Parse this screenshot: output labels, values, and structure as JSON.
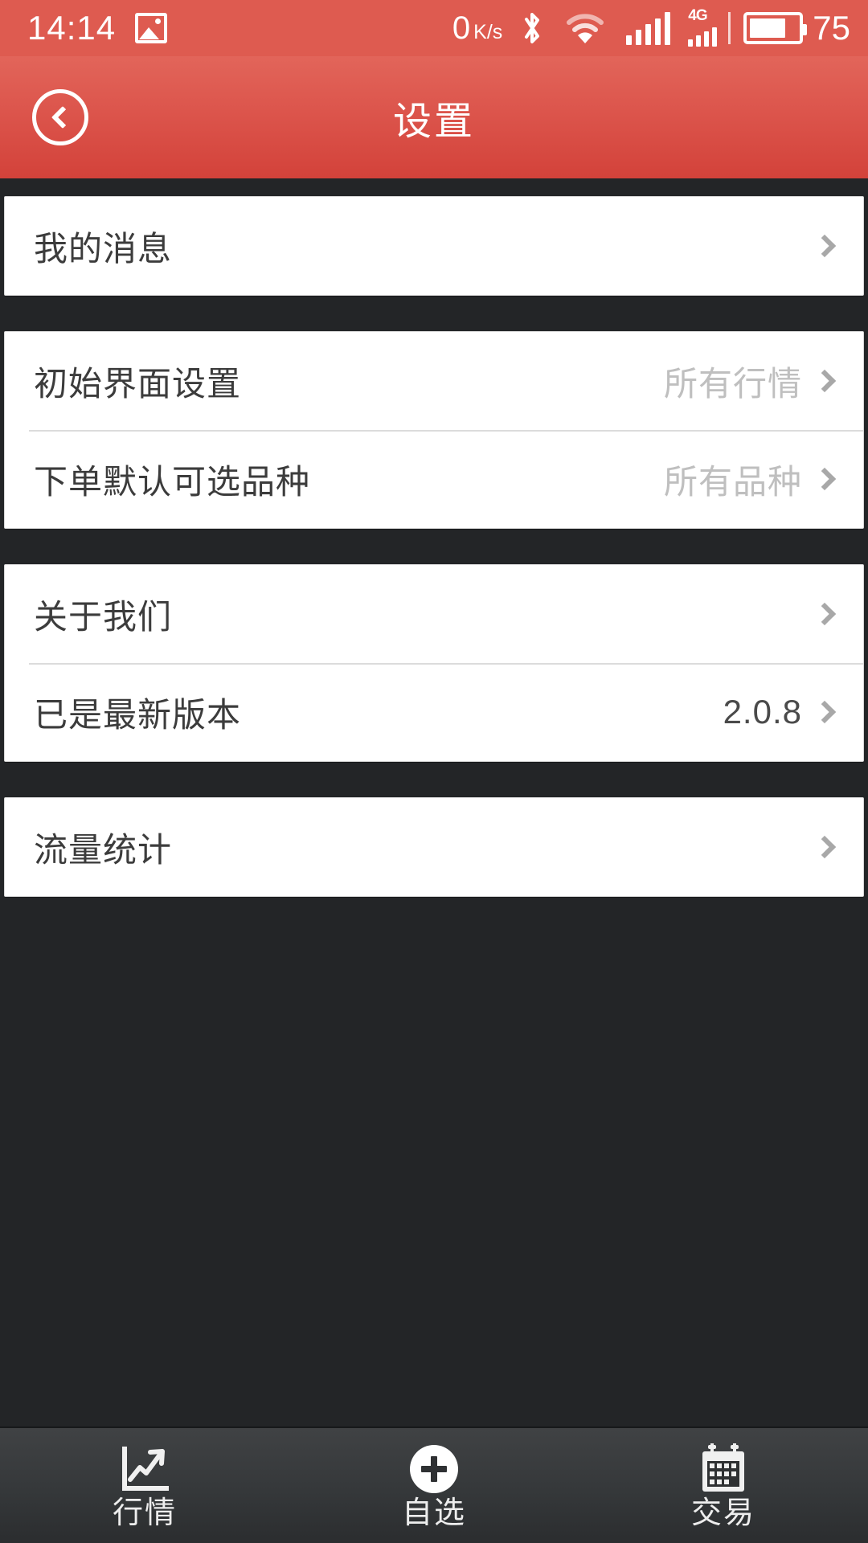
{
  "statusbar": {
    "time": "14:14",
    "gallery_icon": "image-icon",
    "network_speed_value": "0",
    "network_speed_unit": "K/s",
    "bluetooth_icon": "bluetooth-icon",
    "wifi_icon": "wifi-icon",
    "signal_icon": "cellular-signal-icon",
    "signal_4g_label": "4G",
    "battery_icon": "battery-icon",
    "battery_percent": "75"
  },
  "header": {
    "back_icon": "back-arrow-icon",
    "title": "设置"
  },
  "groups": [
    {
      "rows": [
        {
          "label": "我的消息",
          "value": "",
          "value_dark": false
        }
      ]
    },
    {
      "rows": [
        {
          "label": "初始界面设置",
          "value": "所有行情",
          "value_dark": false
        },
        {
          "label": "下单默认可选品种",
          "value": "所有品种",
          "value_dark": false
        }
      ]
    },
    {
      "rows": [
        {
          "label": "关于我们",
          "value": "",
          "value_dark": false
        },
        {
          "label": "已是最新版本",
          "value": "2.0.8",
          "value_dark": true
        }
      ]
    },
    {
      "rows": [
        {
          "label": "流量统计",
          "value": "",
          "value_dark": false
        }
      ]
    }
  ],
  "navbar": {
    "items": [
      {
        "label": "行情",
        "icon": "line-chart-icon"
      },
      {
        "label": "自选",
        "icon": "circle-plus-icon"
      },
      {
        "label": "交易",
        "icon": "calendar-icon"
      }
    ]
  },
  "colors": {
    "status_red": "#DE5B50",
    "header_red_top": "#E2655A",
    "header_red_bottom": "#D3423A",
    "page_background": "#232527",
    "card_background": "#FFFFFF",
    "navbar_background": "#35383A",
    "label_text": "#3C3C3C",
    "value_text": "#BFBFBF",
    "chevron": "#A8A8A8"
  }
}
